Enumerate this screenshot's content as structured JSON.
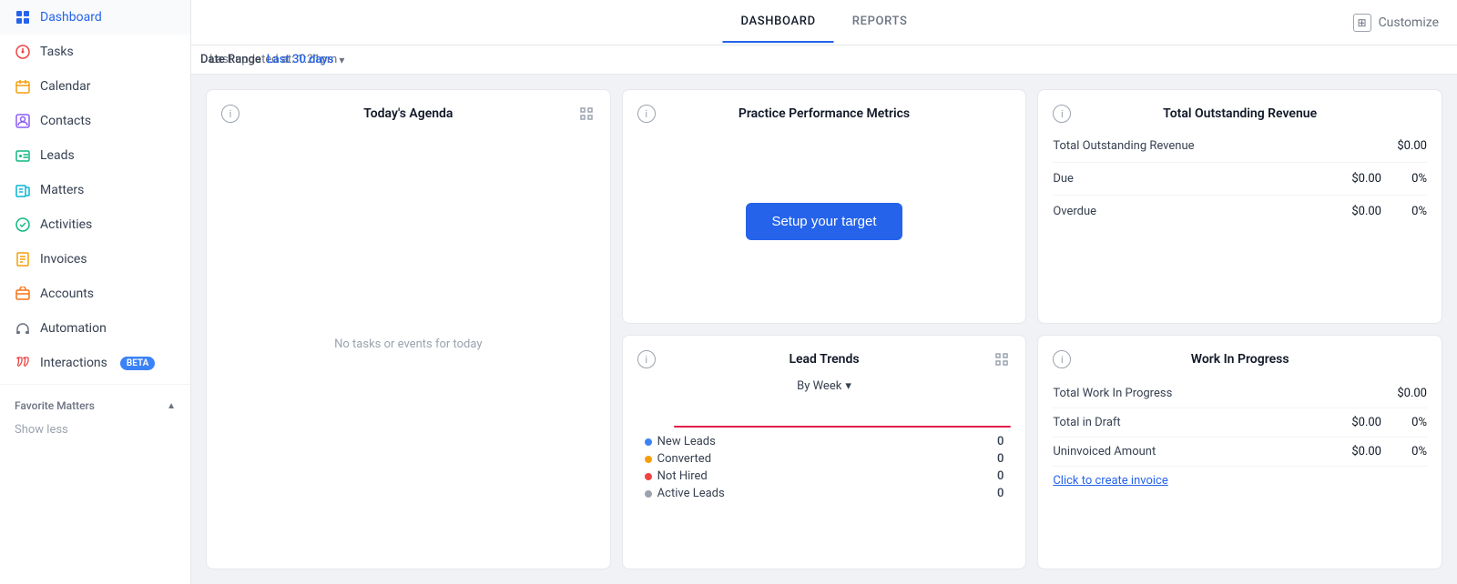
{
  "sidebar": {
    "items": [
      {
        "id": "dashboard",
        "label": "Dashboard",
        "icon": "⊙",
        "active": true,
        "color": "icon-dashboard"
      },
      {
        "id": "tasks",
        "label": "Tasks",
        "icon": "◎",
        "active": false,
        "color": "icon-tasks"
      },
      {
        "id": "calendar",
        "label": "Calendar",
        "icon": "◻",
        "active": false,
        "color": "icon-calendar"
      },
      {
        "id": "contacts",
        "label": "Contacts",
        "icon": "◫",
        "active": false,
        "color": "icon-contacts"
      },
      {
        "id": "leads",
        "label": "Leads",
        "icon": "◈",
        "active": false,
        "color": "icon-leads"
      },
      {
        "id": "matters",
        "label": "Matters",
        "icon": "◧",
        "active": false,
        "color": "icon-matters"
      },
      {
        "id": "activities",
        "label": "Activities",
        "icon": "◉",
        "active": false,
        "color": "icon-activities"
      },
      {
        "id": "invoices",
        "label": "Invoices",
        "icon": "◒",
        "active": false,
        "color": "icon-invoices"
      },
      {
        "id": "accounts",
        "label": "Accounts",
        "icon": "◰",
        "active": false,
        "color": "icon-accounts"
      },
      {
        "id": "automation",
        "label": "Automation",
        "icon": "⇌",
        "active": false,
        "color": "icon-automation"
      },
      {
        "id": "interactions",
        "label": "Interactions",
        "icon": "☎",
        "active": false,
        "color": "icon-interactions",
        "beta": true
      }
    ],
    "favorite_matters_label": "Favorite Matters",
    "show_less_label": "Show less"
  },
  "topbar": {
    "tabs": [
      {
        "id": "dashboard",
        "label": "DASHBOARD",
        "active": true
      },
      {
        "id": "reports",
        "label": "REPORTS",
        "active": false
      }
    ],
    "customize_label": "Customize"
  },
  "subbar": {
    "last_updated_label": "Last updated at: 1:21pm",
    "date_range_label": "Date Range",
    "date_range_value": "Last 30 days"
  },
  "agenda_card": {
    "title": "Today's Agenda",
    "empty_message": "No tasks or events for today"
  },
  "metrics_card": {
    "title": "Practice Performance Metrics",
    "setup_button_label": "Setup your target"
  },
  "lead_trends_card": {
    "title": "Lead Trends",
    "by_week_label": "By Week",
    "legend": [
      {
        "id": "new-leads",
        "label": "New Leads",
        "color": "#3b82f6",
        "value": "0"
      },
      {
        "id": "converted",
        "label": "Converted",
        "color": "#f59e0b",
        "value": "0"
      },
      {
        "id": "not-hired",
        "label": "Not Hired",
        "color": "#ef4444",
        "value": "0"
      },
      {
        "id": "active-leads",
        "label": "Active Leads",
        "color": "#9ca3af",
        "value": "0"
      }
    ]
  },
  "revenue_card": {
    "title": "Total Outstanding Revenue",
    "rows": [
      {
        "id": "total",
        "label": "Total Outstanding Revenue",
        "amount": "$0.00",
        "pct": null
      },
      {
        "id": "due",
        "label": "Due",
        "amount": "$0.00",
        "pct": "0%"
      },
      {
        "id": "overdue",
        "label": "Overdue",
        "amount": "$0.00",
        "pct": "0%"
      }
    ]
  },
  "wip_card": {
    "title": "Work In Progress",
    "rows": [
      {
        "id": "total-wip",
        "label": "Total Work In Progress",
        "amount": "$0.00",
        "pct": null
      },
      {
        "id": "total-draft",
        "label": "Total in Draft",
        "amount": "$0.00",
        "pct": "0%"
      },
      {
        "id": "uninvoiced",
        "label": "Uninvoiced Amount",
        "amount": "$0.00",
        "pct": "0%"
      }
    ],
    "create_invoice_label": "Click to create invoice"
  }
}
